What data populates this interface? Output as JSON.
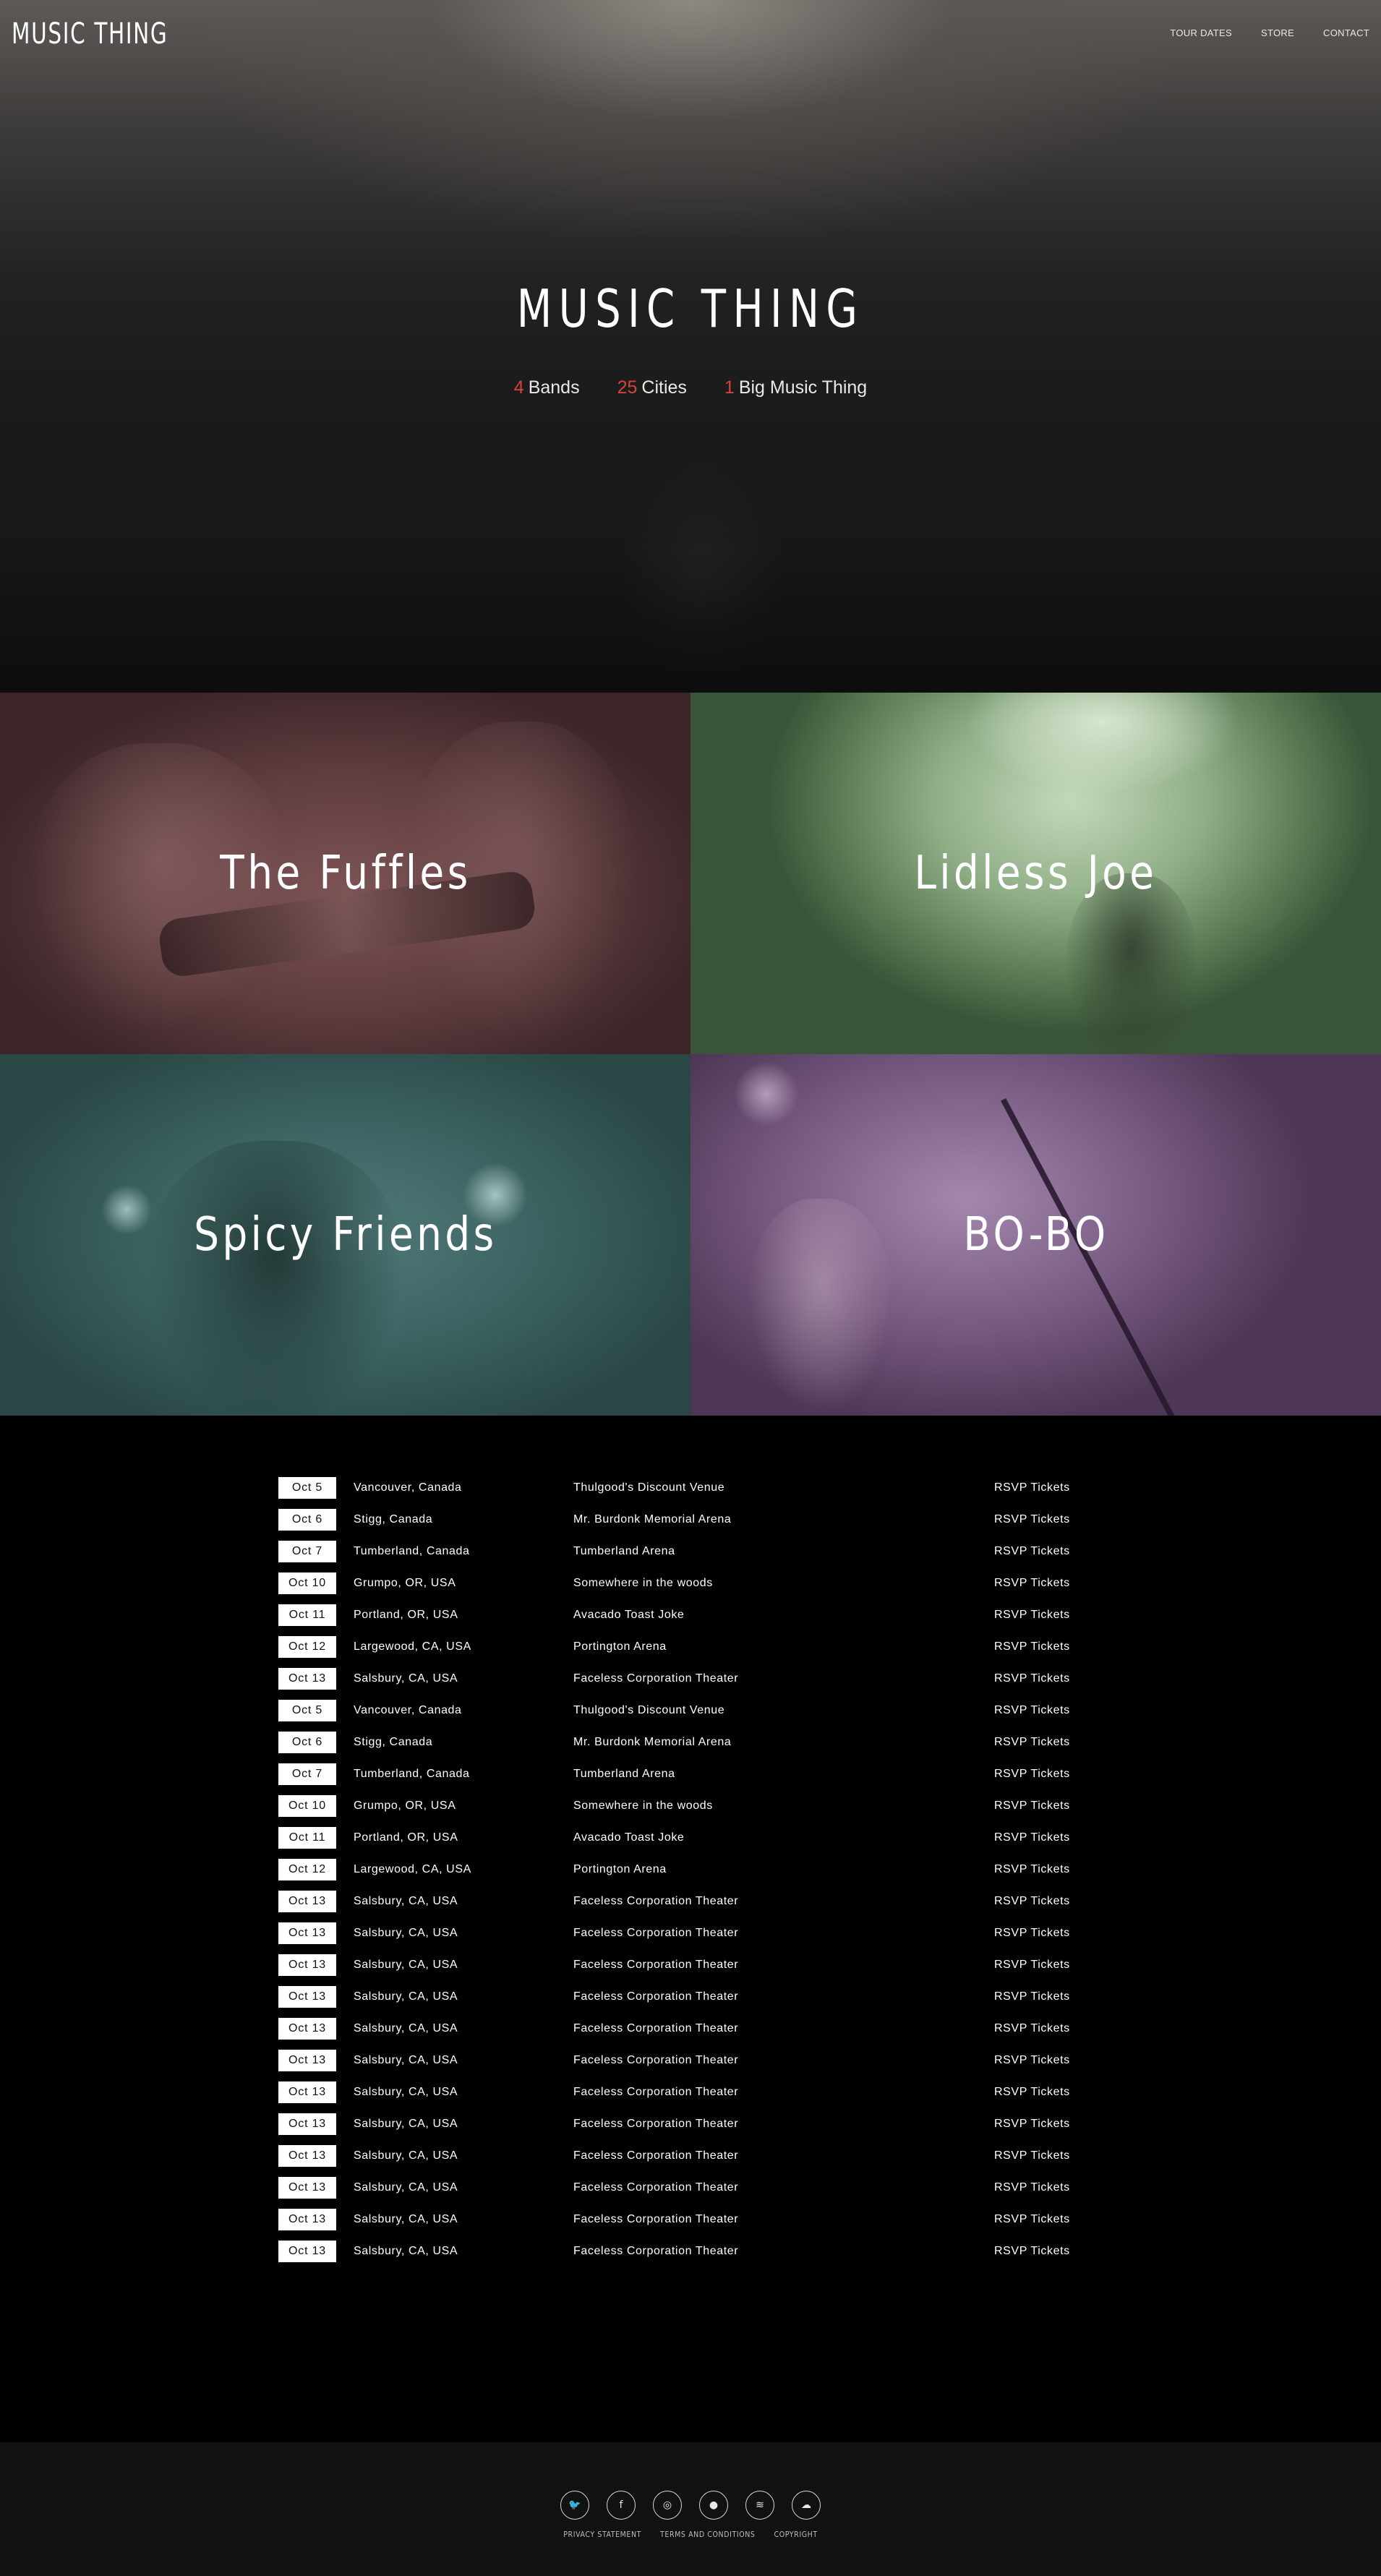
{
  "header": {
    "logo": "MUSIC THING",
    "nav": [
      {
        "label": "TOUR DATES"
      },
      {
        "label": "STORE"
      },
      {
        "label": "CONTACT"
      }
    ]
  },
  "hero": {
    "title": "MUSIC THING",
    "stats": [
      {
        "number": "4",
        "label": "Bands"
      },
      {
        "number": "25",
        "label": "Cities"
      },
      {
        "number": "1",
        "label": "Big Music Thing"
      }
    ]
  },
  "bands": [
    {
      "name": "The Fuffles",
      "tint": "#6b4649"
    },
    {
      "name": "Lidless Joe",
      "tint": "#8fae86"
    },
    {
      "name": "Spicy Friends",
      "tint": "#3d6462"
    },
    {
      "name": "BO-BO",
      "tint": "#7b5e85"
    }
  ],
  "tour": {
    "rsvp_label": "RSVP Tickets",
    "rows": [
      {
        "date": "Oct 5",
        "city": "Vancouver, Canada",
        "venue": "Thulgood's Discount Venue"
      },
      {
        "date": "Oct 6",
        "city": "Stigg, Canada",
        "venue": "Mr. Burdonk Memorial Arena"
      },
      {
        "date": "Oct 7",
        "city": "Tumberland, Canada",
        "venue": "Tumberland Arena"
      },
      {
        "date": "Oct 10",
        "city": "Grumpo, OR, USA",
        "venue": "Somewhere in the woods"
      },
      {
        "date": "Oct 11",
        "city": "Portland, OR, USA",
        "venue": "Avacado Toast Joke"
      },
      {
        "date": "Oct 12",
        "city": "Largewood, CA, USA",
        "venue": "Portington Arena"
      },
      {
        "date": "Oct 13",
        "city": "Salsbury, CA, USA",
        "venue": "Faceless Corporation Theater"
      },
      {
        "date": "Oct 5",
        "city": "Vancouver, Canada",
        "venue": "Thulgood's Discount Venue"
      },
      {
        "date": "Oct 6",
        "city": "Stigg, Canada",
        "venue": "Mr. Burdonk Memorial Arena"
      },
      {
        "date": "Oct 7",
        "city": "Tumberland, Canada",
        "venue": "Tumberland Arena"
      },
      {
        "date": "Oct 10",
        "city": "Grumpo, OR, USA",
        "venue": "Somewhere in the woods"
      },
      {
        "date": "Oct 11",
        "city": "Portland, OR, USA",
        "venue": "Avacado Toast Joke"
      },
      {
        "date": "Oct 12",
        "city": "Largewood, CA, USA",
        "venue": "Portington Arena"
      },
      {
        "date": "Oct 13",
        "city": "Salsbury, CA, USA",
        "venue": "Faceless Corporation Theater"
      },
      {
        "date": "Oct 13",
        "city": "Salsbury, CA, USA",
        "venue": "Faceless Corporation Theater"
      },
      {
        "date": "Oct 13",
        "city": "Salsbury, CA, USA",
        "venue": "Faceless Corporation Theater"
      },
      {
        "date": "Oct 13",
        "city": "Salsbury, CA, USA",
        "venue": "Faceless Corporation Theater"
      },
      {
        "date": "Oct 13",
        "city": "Salsbury, CA, USA",
        "venue": "Faceless Corporation Theater"
      },
      {
        "date": "Oct 13",
        "city": "Salsbury, CA, USA",
        "venue": "Faceless Corporation Theater"
      },
      {
        "date": "Oct 13",
        "city": "Salsbury, CA, USA",
        "venue": "Faceless Corporation Theater"
      },
      {
        "date": "Oct 13",
        "city": "Salsbury, CA, USA",
        "venue": "Faceless Corporation Theater"
      },
      {
        "date": "Oct 13",
        "city": "Salsbury, CA, USA",
        "venue": "Faceless Corporation Theater"
      },
      {
        "date": "Oct 13",
        "city": "Salsbury, CA, USA",
        "venue": "Faceless Corporation Theater"
      },
      {
        "date": "Oct 13",
        "city": "Salsbury, CA, USA",
        "venue": "Faceless Corporation Theater"
      },
      {
        "date": "Oct 13",
        "city": "Salsbury, CA, USA",
        "venue": "Faceless Corporation Theater"
      }
    ]
  },
  "footer": {
    "social": [
      {
        "icon": "twitter-icon",
        "glyph": "🐦"
      },
      {
        "icon": "facebook-icon",
        "glyph": "f"
      },
      {
        "icon": "instagram-icon",
        "glyph": "◎"
      },
      {
        "icon": "circle-logo-icon",
        "glyph": "●"
      },
      {
        "icon": "spotify-icon",
        "glyph": "≋"
      },
      {
        "icon": "soundcloud-icon",
        "glyph": "☁"
      }
    ],
    "links": [
      {
        "label": "PRIVACY STATEMENT"
      },
      {
        "label": "TERMS AND CONDITIONS"
      },
      {
        "label": "COPYRIGHT"
      }
    ]
  }
}
